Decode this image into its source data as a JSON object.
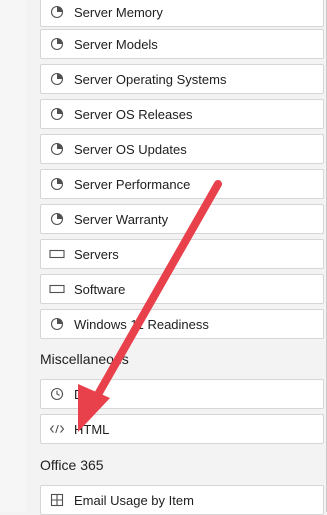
{
  "catalog": {
    "items_top": [
      {
        "label": "Server Memory",
        "icon": "chart-pie-icon"
      },
      {
        "label": "Server Models",
        "icon": "chart-pie-icon"
      },
      {
        "label": "Server Operating Systems",
        "icon": "chart-pie-icon"
      },
      {
        "label": "Server OS Releases",
        "icon": "chart-pie-icon"
      },
      {
        "label": "Server OS Updates",
        "icon": "chart-pie-icon"
      },
      {
        "label": "Server Performance",
        "icon": "chart-pie-icon"
      },
      {
        "label": "Server Warranty",
        "icon": "chart-pie-icon"
      },
      {
        "label": "Servers",
        "icon": "table-rectangle-icon"
      },
      {
        "label": "Software",
        "icon": "table-rectangle-icon"
      },
      {
        "label": "Windows 11 Readiness",
        "icon": "chart-pie-icon"
      }
    ],
    "misc_heading": "Miscellaneous",
    "misc_items": [
      {
        "label": "Date",
        "icon": "clock-icon"
      },
      {
        "label": "HTML",
        "icon": "code-icon"
      }
    ],
    "office_heading": "Office 365",
    "office_items": [
      {
        "label": "Email Usage by Item",
        "icon": "grid-icon"
      }
    ]
  },
  "colors": {
    "annotation_arrow": "#e8414b",
    "item_border": "#d6d6d6",
    "background": "#f3f3f3"
  }
}
